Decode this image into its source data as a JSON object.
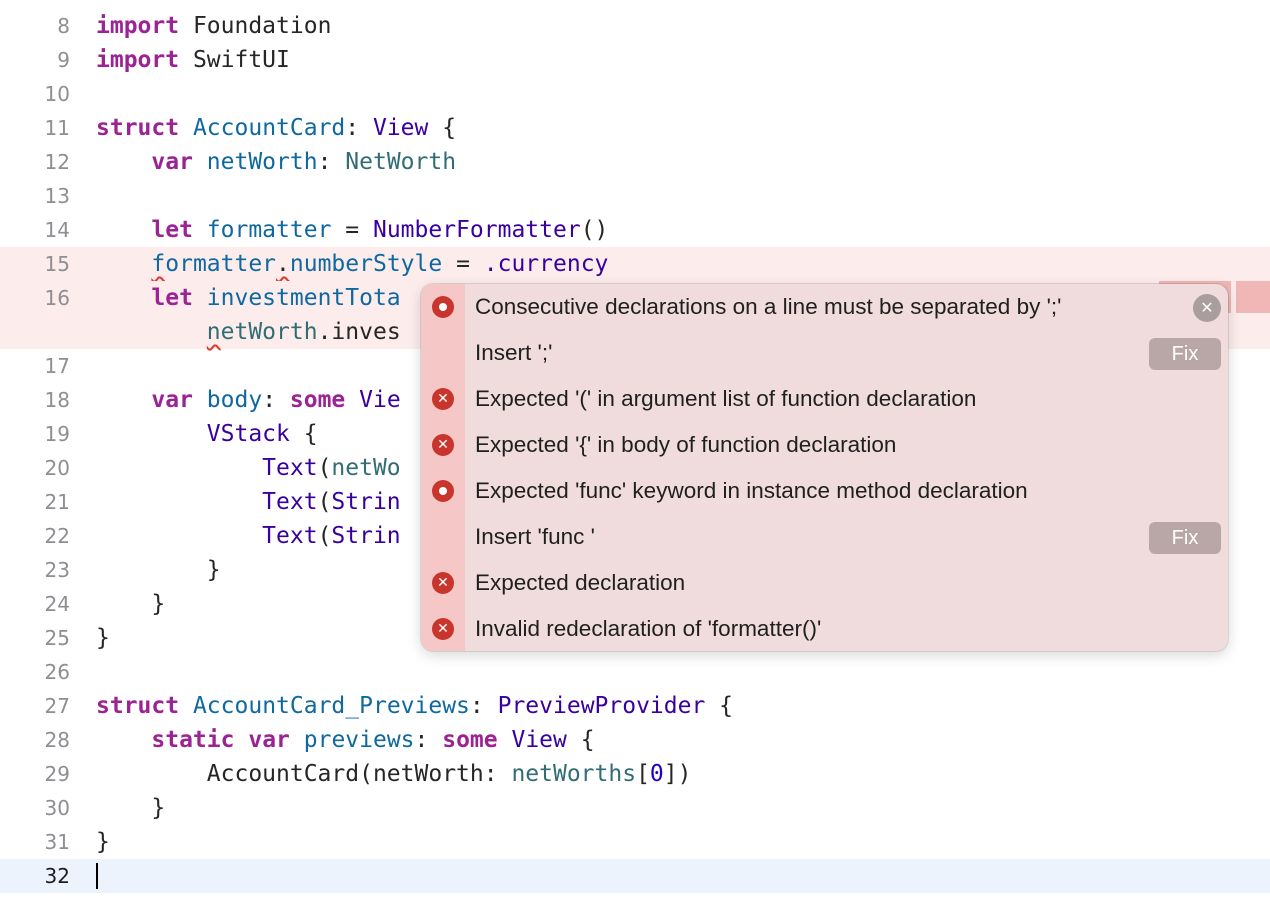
{
  "editor": {
    "language": "Swift",
    "lines": [
      {
        "n": "8",
        "tokens": [
          [
            "import",
            "kw"
          ],
          [
            " Foundation",
            "plain"
          ]
        ]
      },
      {
        "n": "9",
        "tokens": [
          [
            "import",
            "kw"
          ],
          [
            " SwiftUI",
            "plain"
          ]
        ]
      },
      {
        "n": "10",
        "tokens": []
      },
      {
        "n": "11",
        "tokens": [
          [
            "struct",
            "kw"
          ],
          [
            " ",
            "plain"
          ],
          [
            "AccountCard",
            "decl"
          ],
          [
            ": ",
            "plain"
          ],
          [
            "View",
            "type"
          ],
          [
            " {",
            "plain"
          ]
        ]
      },
      {
        "n": "12",
        "tokens": [
          [
            "    ",
            "plain"
          ],
          [
            "var",
            "kw"
          ],
          [
            " ",
            "plain"
          ],
          [
            "netWorth",
            "decl"
          ],
          [
            ": ",
            "plain"
          ],
          [
            "NetWorth",
            "call"
          ]
        ]
      },
      {
        "n": "13",
        "tokens": []
      },
      {
        "n": "14",
        "tokens": [
          [
            "    ",
            "plain"
          ],
          [
            "let",
            "kw"
          ],
          [
            " ",
            "plain"
          ],
          [
            "formatter",
            "decl"
          ],
          [
            " = ",
            "plain"
          ],
          [
            "NumberFormatter",
            "type"
          ],
          [
            "()",
            "plain"
          ]
        ]
      },
      {
        "n": "15",
        "error": true,
        "tokens": [
          [
            "    ",
            "plain"
          ],
          [
            "f",
            "decl",
            "sq"
          ],
          [
            "ormatter",
            "decl"
          ],
          [
            ".",
            "plain",
            "sq"
          ],
          [
            "numberStyle",
            "decl"
          ],
          [
            " = ",
            "plain"
          ],
          [
            ".currency",
            "type"
          ]
        ]
      },
      {
        "n": "16",
        "error": true,
        "tokens": [
          [
            "    ",
            "plain"
          ],
          [
            "let",
            "kw"
          ],
          [
            " ",
            "plain"
          ],
          [
            "investmentTota",
            "decl"
          ]
        ]
      },
      {
        "n": "",
        "error": true,
        "tokens": [
          [
            "        ",
            "plain"
          ],
          [
            "n",
            "call",
            "sq"
          ],
          [
            "etWorth",
            "call"
          ],
          [
            ".inves",
            "plain"
          ]
        ]
      },
      {
        "n": "17",
        "tokens": []
      },
      {
        "n": "18",
        "tokens": [
          [
            "    ",
            "plain"
          ],
          [
            "var",
            "kw"
          ],
          [
            " ",
            "plain"
          ],
          [
            "body",
            "decl"
          ],
          [
            ": ",
            "plain"
          ],
          [
            "some",
            "kw"
          ],
          [
            " ",
            "plain"
          ],
          [
            "Vie",
            "type"
          ]
        ]
      },
      {
        "n": "19",
        "tokens": [
          [
            "        ",
            "plain"
          ],
          [
            "VStack",
            "type"
          ],
          [
            " {",
            "plain"
          ]
        ]
      },
      {
        "n": "20",
        "tokens": [
          [
            "            ",
            "plain"
          ],
          [
            "Text",
            "type"
          ],
          [
            "(",
            "plain"
          ],
          [
            "netWo",
            "call"
          ]
        ]
      },
      {
        "n": "21",
        "tokens": [
          [
            "            ",
            "plain"
          ],
          [
            "Text",
            "type"
          ],
          [
            "(",
            "plain"
          ],
          [
            "Strin",
            "type"
          ]
        ]
      },
      {
        "n": "22",
        "tokens": [
          [
            "            ",
            "plain"
          ],
          [
            "Text",
            "type"
          ],
          [
            "(",
            "plain"
          ],
          [
            "Strin",
            "type"
          ]
        ]
      },
      {
        "n": "23",
        "tokens": [
          [
            "        }",
            "plain"
          ]
        ]
      },
      {
        "n": "24",
        "tokens": [
          [
            "    }",
            "plain"
          ]
        ]
      },
      {
        "n": "25",
        "tokens": [
          [
            "}",
            "plain"
          ]
        ]
      },
      {
        "n": "26",
        "tokens": []
      },
      {
        "n": "27",
        "tokens": [
          [
            "struct",
            "kw"
          ],
          [
            " ",
            "plain"
          ],
          [
            "AccountCard_Previews",
            "decl"
          ],
          [
            ": ",
            "plain"
          ],
          [
            "PreviewProvider",
            "type"
          ],
          [
            " {",
            "plain"
          ]
        ]
      },
      {
        "n": "28",
        "tokens": [
          [
            "    ",
            "plain"
          ],
          [
            "static",
            "kw"
          ],
          [
            " ",
            "plain"
          ],
          [
            "var",
            "kw"
          ],
          [
            " ",
            "plain"
          ],
          [
            "previews",
            "decl"
          ],
          [
            ": ",
            "plain"
          ],
          [
            "some",
            "kw"
          ],
          [
            " ",
            "plain"
          ],
          [
            "View",
            "type"
          ],
          [
            " {",
            "plain"
          ]
        ]
      },
      {
        "n": "29",
        "tokens": [
          [
            "        ",
            "plain"
          ],
          [
            "AccountCard",
            "plain"
          ],
          [
            "(netWorth: ",
            "plain"
          ],
          [
            "netWorths",
            "call"
          ],
          [
            "[",
            "plain"
          ],
          [
            "0",
            "num"
          ],
          [
            "])",
            "plain"
          ]
        ]
      },
      {
        "n": "30",
        "tokens": [
          [
            "    }",
            "plain"
          ]
        ]
      },
      {
        "n": "31",
        "tokens": [
          [
            "}",
            "plain"
          ]
        ]
      },
      {
        "n": "32",
        "current": true,
        "tokens": []
      }
    ]
  },
  "issues": {
    "close_icon": "close-circle-icon",
    "items": [
      {
        "icon": "error-dot-icon",
        "text": "Consecutive declarations on a line must be separated by ';'",
        "close": true
      },
      {
        "icon": "",
        "text": "Insert ';'",
        "fix": "Fix"
      },
      {
        "icon": "error-x-icon",
        "text": "Expected '(' in argument list of function declaration"
      },
      {
        "icon": "error-x-icon",
        "text": "Expected '{' in body of function declaration"
      },
      {
        "icon": "error-dot-icon",
        "text": "Expected 'func' keyword in instance method declaration"
      },
      {
        "icon": "",
        "text": "Insert 'func '",
        "fix": "Fix"
      },
      {
        "icon": "error-x-icon",
        "text": "Expected declaration"
      },
      {
        "icon": "error-x-icon",
        "text": "Invalid redeclaration of 'formatter()'"
      }
    ]
  },
  "colors": {
    "keyword": "#9b2393",
    "type": "#3900a0",
    "declaration": "#0f68a0",
    "reference": "#326d74",
    "number": "#1c00cf",
    "error_line": "#fcecec",
    "current_line": "#edf3fd",
    "popover": "#f0dcdc",
    "error_icon": "#c8352d"
  }
}
